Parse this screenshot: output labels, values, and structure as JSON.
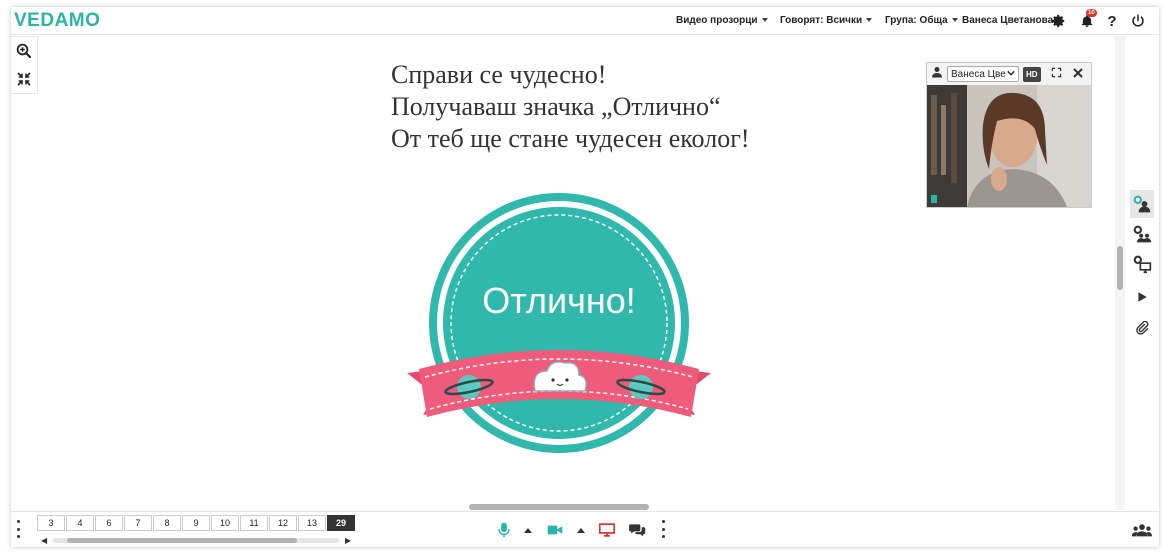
{
  "app": {
    "logo": "VEDAMO",
    "brand_color": "#2ab5a5"
  },
  "header": {
    "video_windows_label": "Видео прозорци",
    "speaking_label": "Говорят: Всички",
    "group_label": "Група: Обща",
    "user_name": "Ванеса Цветанова",
    "notification_count": "10",
    "icons": [
      "gear-icon",
      "bell-icon",
      "help-icon",
      "power-icon"
    ]
  },
  "zoom_tools": [
    "zoom-in-icon",
    "fit-screen-icon"
  ],
  "slide": {
    "lines": [
      "Справи се чудесно!",
      "Получаваш значка „Отлично“",
      "От теб ще стане чудесен еколог!"
    ],
    "badge_text": "Отлично!",
    "badge_colors": {
      "circle": "#2fb8ab",
      "ribbon": "#ef5b7a"
    }
  },
  "video": {
    "participant": "Ванеса Цве",
    "hd_label": "HD",
    "icons": [
      "user-icon",
      "expand-icon",
      "close-icon"
    ]
  },
  "right_sidebar": [
    "participants-icon",
    "groups-icon",
    "screen-share-icon",
    "play-icon",
    "attachment-icon"
  ],
  "pagination": {
    "pages": [
      "3",
      "4",
      "6",
      "7",
      "8",
      "9",
      "10",
      "11",
      "12",
      "13",
      "29"
    ],
    "current": "29"
  },
  "media_controls": [
    "microphone-icon",
    "camera-icon",
    "screen-share-icon",
    "chat-icon"
  ],
  "status_colors": {
    "mic": "#2ab5a5",
    "camera": "#2ab5a5",
    "screen": "#d9342b"
  }
}
